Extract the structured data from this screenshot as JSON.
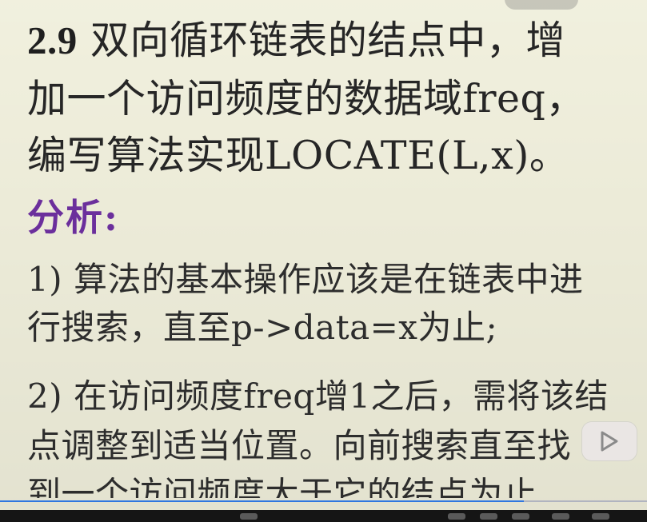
{
  "problem": {
    "number": "2.9",
    "line1_rest": " 双向循环链表的结点中，增",
    "line2": "加一个访问频度的数据域freq，",
    "line3": "编写算法实现LOCATE(L,x)。"
  },
  "analysis": {
    "heading": "分析:",
    "lines": [
      "1) 算法的基本操作应该是在链表中进",
      "行搜索，直至p->data=x为止;",
      "2) 在访问频度freq增1之后，需将该结",
      "点调整到适当位置。向前搜索直至找",
      "到一个访问频度大于它的结点为止"
    ]
  },
  "player": {
    "progress_fraction": 0.81,
    "accent_color": "#2f76e0",
    "play_icon": "play-icon"
  }
}
